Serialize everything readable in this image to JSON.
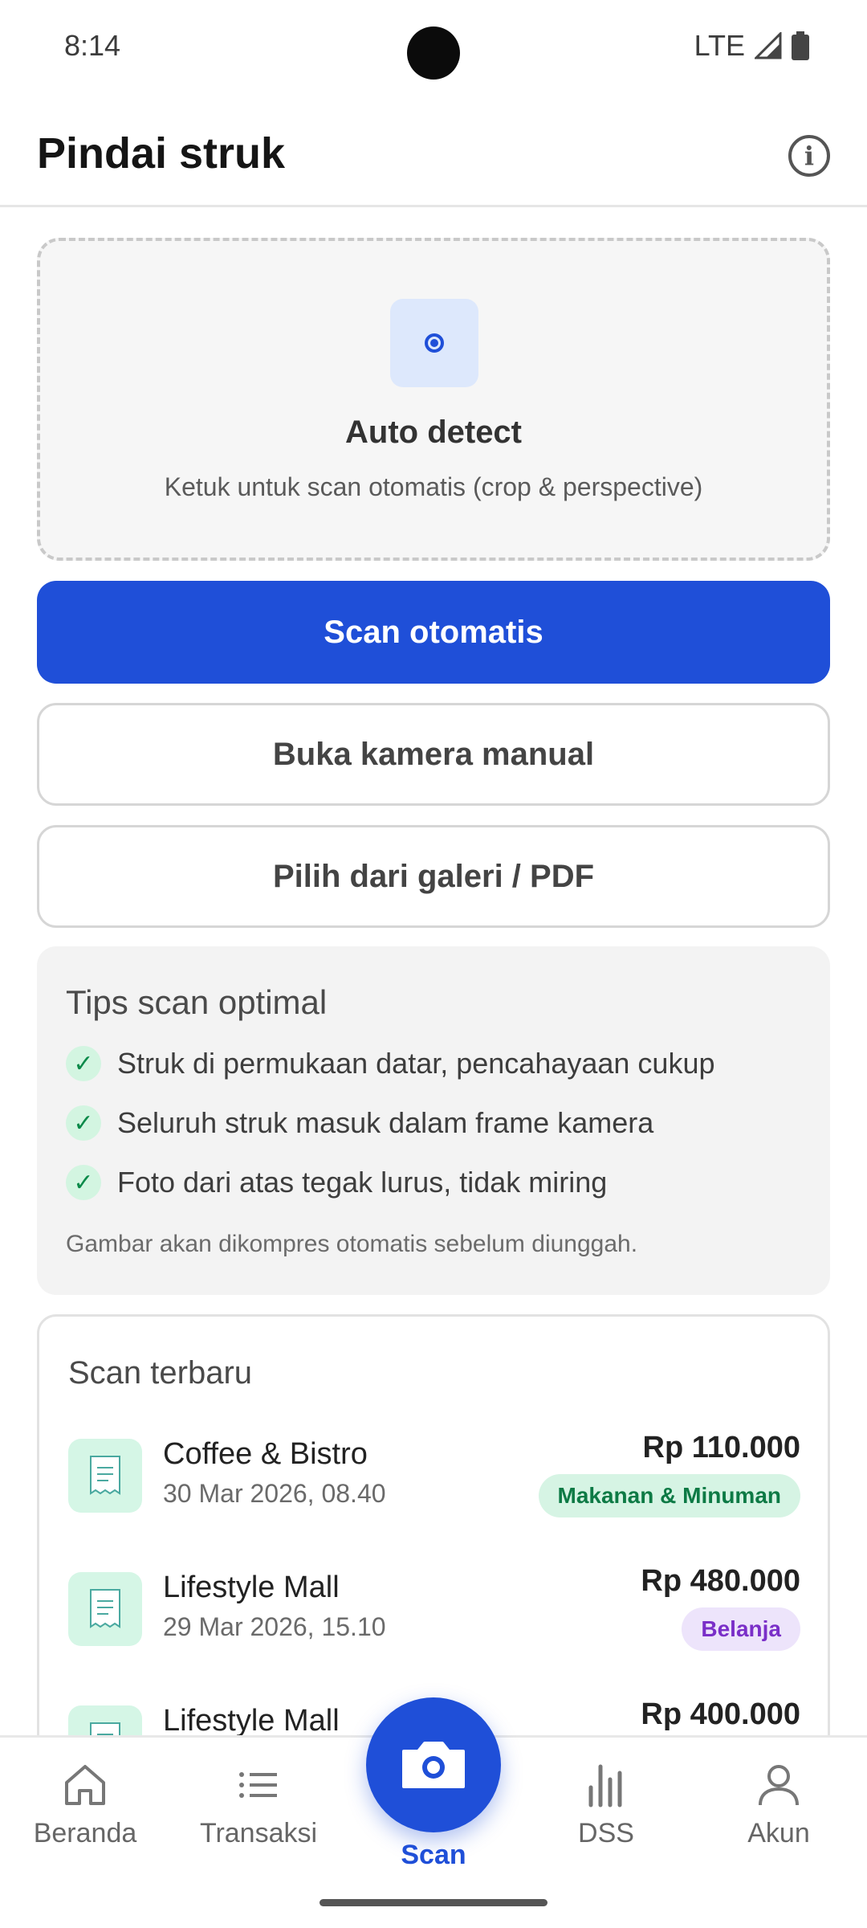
{
  "status_bar": {
    "time": "8:14",
    "network": "LTE"
  },
  "header": {
    "title": "Pindai struk",
    "info_icon": "info-icon"
  },
  "auto_detect": {
    "title": "Auto detect",
    "subtitle": "Ketuk untuk scan otomatis (crop & perspective)"
  },
  "buttons": {
    "scan_auto": "Scan otomatis",
    "manual_camera": "Buka kamera manual",
    "gallery": "Pilih dari galeri / PDF"
  },
  "tips": {
    "title": "Tips scan optimal",
    "items": [
      "Struk di permukaan datar, pencahayaan cukup",
      "Seluruh struk masuk dalam frame kamera",
      "Foto dari atas tegak lurus, tidak miring"
    ],
    "check_glyph": "✓",
    "note": "Gambar akan dikompres otomatis sebelum diunggah."
  },
  "recent": {
    "title": "Scan terbaru",
    "items": [
      {
        "merchant": "Coffee & Bistro",
        "date": "30 Mar 2026, 08.40",
        "amount": "Rp 110.000",
        "category": "Makanan & Minuman"
      },
      {
        "merchant": "Lifestyle Mall",
        "date": "29 Mar 2026, 15.10",
        "amount": "Rp 480.000",
        "category": "Belanja"
      },
      {
        "merchant": "Lifestyle Mall",
        "amount": "Rp 400.000"
      }
    ]
  },
  "nav": {
    "items": [
      {
        "label": "Beranda",
        "icon": "home-icon"
      },
      {
        "label": "Transaksi",
        "icon": "list-icon"
      },
      {
        "label": "Scan",
        "icon": "camera-icon"
      },
      {
        "label": "DSS",
        "icon": "bar-chart-icon"
      },
      {
        "label": "Akun",
        "icon": "user-icon"
      }
    ]
  },
  "colors": {
    "primary": "#1f4fd8",
    "food_badge_bg": "#d6f4e4",
    "food_badge_text": "#0d7a45",
    "shop_badge_bg": "#ede4fb",
    "shop_badge_text": "#7a2fc8"
  }
}
